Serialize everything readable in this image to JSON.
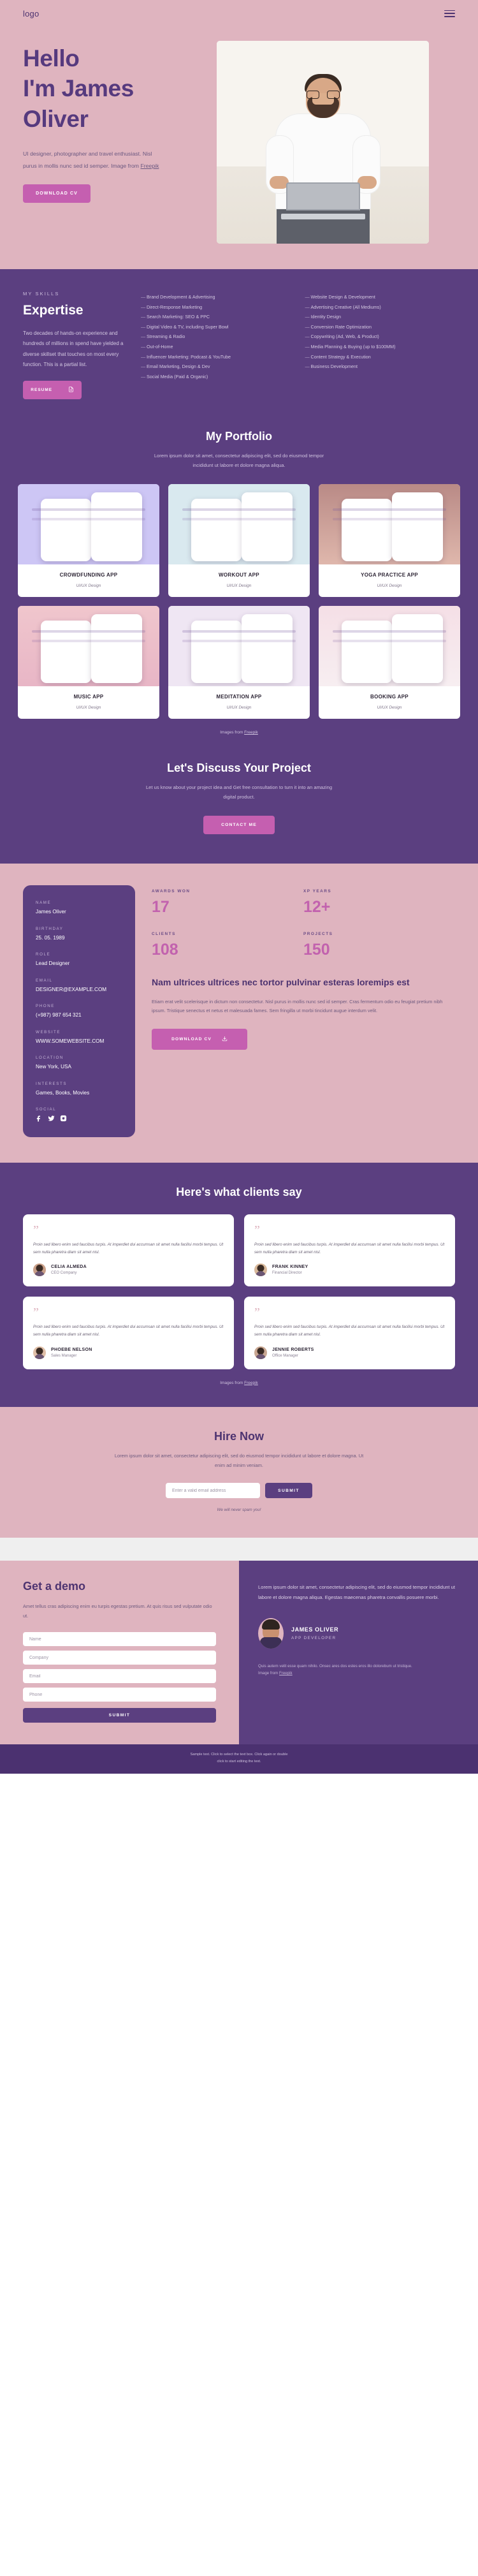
{
  "colors": {
    "pink_bg": "#dfb4bf",
    "purple_bg": "#5b3f80",
    "accent_pink": "#c55fb0",
    "heading_purple": "#4d3370"
  },
  "header": {
    "logo": "logo",
    "menu_icon": "hamburger-menu-icon"
  },
  "hero": {
    "title_line1": "Hello",
    "title_line2": "I'm James",
    "title_line3": "Oliver",
    "description": "UI designer, photographer and travel enthusiast. Nisl purus in mollis nunc sed id semper.  Image from ",
    "description_link": "Freepik",
    "cta": "DOWNLOAD CV"
  },
  "skills": {
    "eyebrow": "MY SKILLS",
    "title": "Expertise",
    "paragraph": "Two decades of hands-on experience and hundreds of millions in spend have yielded a diverse skillset that touches on most every function. This is a partial list.",
    "resume_button": "RESUME",
    "resume_icon": "document-download-icon",
    "column1": [
      "Brand Development & Advertising",
      "Direct-Response Marketing",
      "Search Marketing: SEO & PPC",
      "Digital Video & TV, including Super Bowl",
      "Streaming & Radio",
      "Out-of-Home",
      "Influencer Marketing: Podcast & YouTube",
      "Email Marketing, Design & Dev",
      "Social Media (Paid & Organic)"
    ],
    "column2": [
      "Website Design & Development",
      "Advertising Creative (All Mediums)",
      "Identity Design",
      "Conversion Rate Optimization",
      "Copywriting (Ad, Web, & Product)",
      "Media Planning & Buying (up to $100MM)",
      "Content Strategy & Execution",
      "Business Development"
    ]
  },
  "portfolio": {
    "title": "My Portfolio",
    "subtitle": "Lorem ipsum dolor sit amet, consectetur adipiscing elit, sed do eiusmod tempor incididunt ut labore et dolore magna aliqua.",
    "credit_prefix": "Images from ",
    "credit_link": "Freepik",
    "items": [
      {
        "title": "CROWDFUNDING APP",
        "category": "UI/UX Design",
        "theme": "t1"
      },
      {
        "title": "WORKOUT APP",
        "category": "UI/UX Design",
        "theme": "t2"
      },
      {
        "title": "YOGA PRACTICE APP",
        "category": "UI/UX Design",
        "theme": "t3"
      },
      {
        "title": "MUSIC APP",
        "category": "UI/UX Design",
        "theme": "t4"
      },
      {
        "title": "MEDITATION APP",
        "category": "UI/UX Design",
        "theme": "t5"
      },
      {
        "title": "BOOKING  APP",
        "category": "UI/UX Design",
        "theme": "t6"
      }
    ]
  },
  "discuss": {
    "title": "Let's Discuss Your Project",
    "subtitle": "Let us know about your project idea and Get free consultation to turn it into an amazing digital product.",
    "cta": "CONTACT ME"
  },
  "info": {
    "card": {
      "fields": [
        {
          "label": "NAME",
          "value": "James Oliver"
        },
        {
          "label": "BIRTHDAY",
          "value": "25. 05. 1989"
        },
        {
          "label": "ROLE",
          "value": "Lead Designer"
        },
        {
          "label": "EMAIL",
          "value": "DESIGNER@EXAMPLE.COM"
        },
        {
          "label": "PHONE",
          "value": "(+987) 987 654 321"
        },
        {
          "label": "WEBSITE",
          "value": "WWW.SOMEWEBSITE.COM"
        },
        {
          "label": "LOCATION",
          "value": "New York, USA"
        },
        {
          "label": "INTERESTS",
          "value": "Games, Books, Movies"
        }
      ],
      "social_label": "SOCIAL",
      "socials": [
        "facebook-icon",
        "twitter-icon",
        "instagram-icon"
      ]
    },
    "stats": [
      {
        "label": "AWARDS WON",
        "value": "17"
      },
      {
        "label": "XP YEARS",
        "value": "12+"
      },
      {
        "label": "CLIENTS",
        "value": "108"
      },
      {
        "label": "PROJECTS",
        "value": "150"
      }
    ],
    "heading": "Nam ultrices ultrices nec tortor pulvinar esteras loremips est",
    "paragraph": "Etiam erat velit scelerisque in dictum non consectetur. Nisl purus in mollis nunc sed id semper. Cras fermentum odio eu feugiat pretium nibh ipsum. Tristique senectus et netus et malesuada fames. Sem fringilla ut morbi tincidunt augue interdum velit.",
    "cta": "DOWNLOAD CV",
    "cta_icon": "download-icon"
  },
  "testimonials": {
    "title": "Here's what clients say",
    "quote_icon": "quotation-mark-icon",
    "items": [
      {
        "text": "Proin sed libero enim sed faucibus turpis. At imperdiet dui accumsan sit amet nulla facilisi morbi tempus. Ut sem nulla pharetra diam sit amet nisl.",
        "name": "CELIA ALMEDA",
        "role": "CEO Company"
      },
      {
        "text": "Proin sed libero enim sed faucibus turpis. At imperdiet dui accumsan sit amet nulla facilisi morbi tempus. Ut sem nulla pharetra diam sit amet nisl.",
        "name": "FRANK KINNEY",
        "role": "Financial Director"
      },
      {
        "text": "Proin sed libero enim sed faucibus turpis. At imperdiet dui accumsan sit amet nulla facilisi morbi tempus. Ut sem nulla pharetra diam sit amet nisl.",
        "name": "PHOEBE NELSON",
        "role": "Sales Manager"
      },
      {
        "text": "Proin sed libero enim sed faucibus turpis. At imperdiet dui accumsan sit amet nulla facilisi morbi tempus. Ut sem nulla pharetra diam sit amet nisl.",
        "name": "JENNIE ROBERTS",
        "role": "Office Manager"
      }
    ],
    "credit_prefix": "Images from ",
    "credit_link": "Freepik"
  },
  "hire": {
    "title": "Hire Now",
    "paragraph": "Lorem ipsum dolor sit amet, consectetur adipiscing elit, sed do eiusmod tempor incididunt ut labore et dolore magna. Ut enim ad minim veniam.",
    "email_placeholder": "Enter a valid email address",
    "submit": "SUBMIT",
    "note": "We will never spam you!"
  },
  "demo": {
    "title": "Get a demo",
    "paragraph": "Amet tellus cras adipiscing enim eu turpis egestas pretium. At quis risus sed vulputate odio ut.",
    "fields": [
      {
        "placeholder": "Name"
      },
      {
        "placeholder": "Company"
      },
      {
        "placeholder": "Email"
      },
      {
        "placeholder": "Phone"
      }
    ],
    "submit": "SUBMIT",
    "right_paragraph": "Lorem ipsum dolor sit amet, consectetur adipiscing elit, sed do eiusmod tempor incididunt ut labore et dolore magna aliqua. Egestas maecenas pharetra convallis posuere morbi.",
    "dev_name": "JAMES OLIVER",
    "dev_role": "APP DEVELOPER",
    "credit": "Quis autem velit esse quam nihilo. Onsec ares dos estes eros illo dolorebum ut tristique.",
    "credit_prefix": "Image from ",
    "credit_link": "Freepik"
  },
  "footer": {
    "line1": "Sample text. Click to select the text box. Click again or double",
    "line2": "click to start editing the text."
  }
}
